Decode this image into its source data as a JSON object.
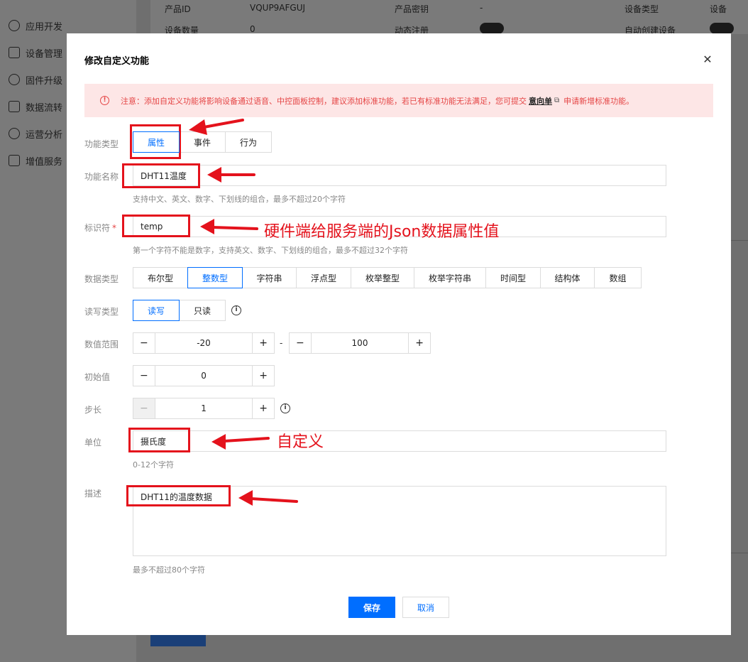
{
  "background": {
    "sidebar_items": [
      "应用开发",
      "设备管理",
      "固件升级",
      "数据流转",
      "运营分析",
      "增值服务"
    ],
    "info": {
      "product_id_label": "产品ID",
      "product_id_value": "VQUP9AFGUJ",
      "product_secret_label": "产品密钥",
      "product_secret_value": "-",
      "device_type_label": "设备类型",
      "device_type_value": "设备",
      "device_count_label": "设备数量",
      "device_count_value": "0",
      "dynamic_register_label": "动态注册",
      "auto_create_label": "自动创建设备"
    }
  },
  "modal": {
    "title": "修改自定义功能",
    "close_icon": "close-icon",
    "alert": {
      "text_before": "注意：添加自定义功能将影响设备通过语音、中控面板控制，建议添加标准功能，若已有标准功能无法满足，您可提交",
      "link": "意向单",
      "text_after": "申请新增标准功能。"
    },
    "function_type": {
      "label": "功能类型",
      "options": [
        "属性",
        "事件",
        "行为"
      ],
      "selected": "属性"
    },
    "function_name": {
      "label": "功能名称",
      "value": "DHT11温度",
      "hint": "支持中文、英文、数字、下划线的组合，最多不超过20个字符"
    },
    "identifier": {
      "label": "标识符",
      "required_mark": "*",
      "value": "temp",
      "hint": "第一个字符不能是数字，支持英文、数字、下划线的组合，最多不超过32个字符"
    },
    "data_type": {
      "label": "数据类型",
      "options": [
        "布尔型",
        "整数型",
        "字符串",
        "浮点型",
        "枚举整型",
        "枚举字符串",
        "时间型",
        "结构体",
        "数组"
      ],
      "selected": "整数型"
    },
    "rw_type": {
      "label": "读写类型",
      "options": [
        "读写",
        "只读"
      ],
      "selected": "读写"
    },
    "range": {
      "label": "数值范围",
      "min": "-20",
      "max": "100",
      "separator": "-"
    },
    "initial": {
      "label": "初始值",
      "value": "0"
    },
    "step": {
      "label": "步长",
      "value": "1"
    },
    "unit": {
      "label": "单位",
      "value": "摄氏度",
      "hint": "0-12个字符"
    },
    "description": {
      "label": "描述",
      "value": "DHT11的温度数据",
      "hint": "最多不超过80个字符"
    },
    "buttons": {
      "save": "保存",
      "cancel": "取消"
    }
  },
  "annotations": {
    "identifier_note": "硬件端给服务端的Json数据属性值",
    "unit_note": "自定义",
    "color": "#e4121c"
  },
  "colors": {
    "primary": "#006eff",
    "alert_bg": "#fde6e6",
    "alert_text": "#e54545"
  }
}
